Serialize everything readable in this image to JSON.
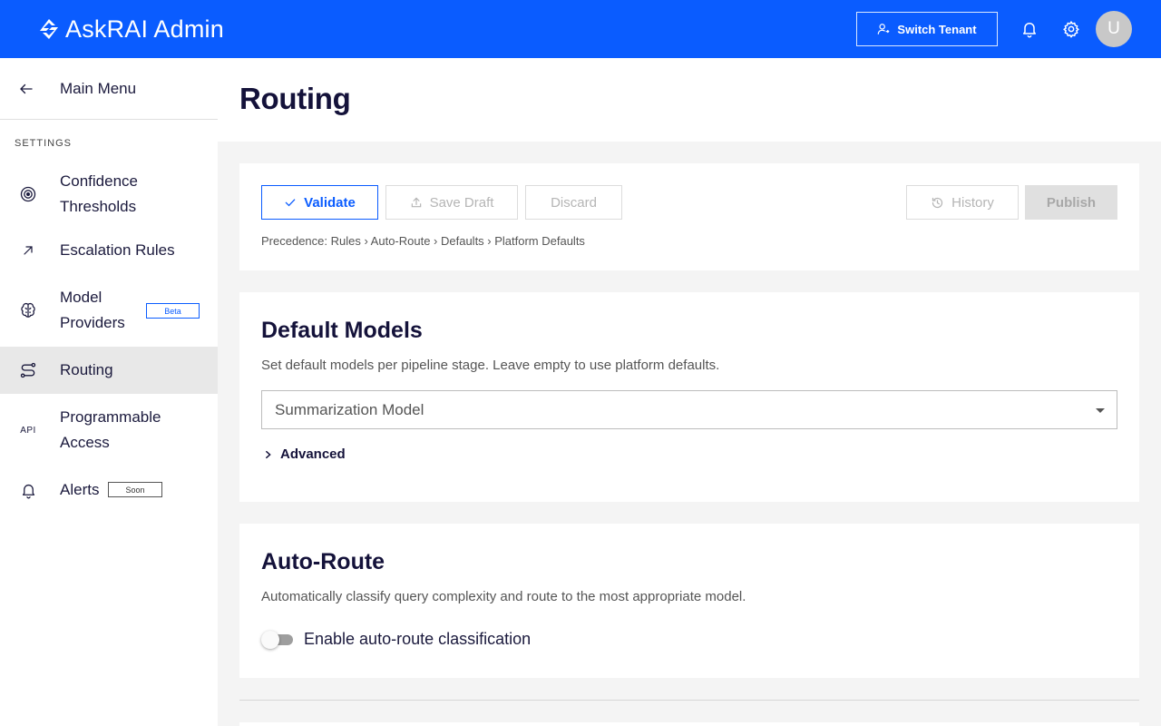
{
  "header": {
    "app_title": "AskRAI Admin",
    "switch_tenant_label": "Switch Tenant",
    "avatar_initial": "U",
    "colors": {
      "primary": "#0a5cff"
    }
  },
  "sidebar": {
    "main_menu_label": "Main Menu",
    "section_label": "SETTINGS",
    "items": [
      {
        "label": "Confidence Thresholds",
        "icon": "target-icon",
        "active": false
      },
      {
        "label": "Escalation Rules",
        "icon": "arrow-up-right-icon",
        "active": false
      },
      {
        "label": "Model Providers",
        "icon": "brain-icon",
        "badge": "Beta",
        "active": false
      },
      {
        "label": "Routing",
        "icon": "route-icon",
        "active": true
      },
      {
        "label": "Programmable Access",
        "icon": "api-icon",
        "icon_text": "API",
        "active": false
      },
      {
        "label": "Alerts",
        "icon": "bell-icon",
        "badge": "Soon",
        "active": false
      }
    ]
  },
  "page": {
    "title": "Routing"
  },
  "toolbar": {
    "validate_label": "Validate",
    "save_draft_label": "Save Draft",
    "discard_label": "Discard",
    "history_label": "History",
    "publish_label": "Publish",
    "precedence_text": "Precedence: Rules › Auto-Route › Defaults › Platform Defaults"
  },
  "default_models": {
    "title": "Default Models",
    "description": "Set default models per pipeline stage. Leave empty to use platform defaults.",
    "select_placeholder": "Summarization Model",
    "advanced_label": "Advanced"
  },
  "auto_route": {
    "title": "Auto-Route",
    "description": "Automatically classify query complexity and route to the most appropriate model.",
    "toggle_label": "Enable auto-route classification",
    "enabled": false
  }
}
